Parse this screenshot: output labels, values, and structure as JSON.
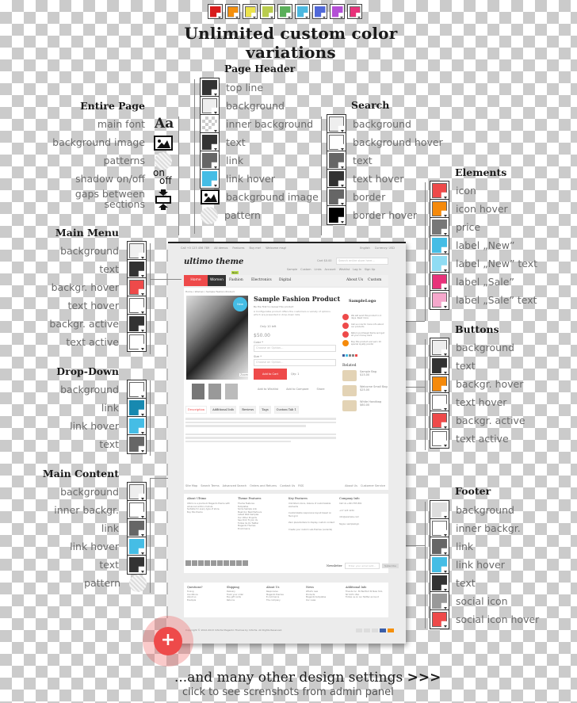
{
  "top_swatches": [
    "#d81c1c",
    "#f5900d",
    "#ece34c",
    "#b9cc4d",
    "#5aaf5a",
    "#4cb8e0",
    "#5068d8",
    "#b44fd6",
    "#e8327a"
  ],
  "headline": "Unlimited custom color variations",
  "entire_page": {
    "title": "Entire Page",
    "items": [
      {
        "label": "main font",
        "icon": "font-icon",
        "glyph": "Aa"
      },
      {
        "label": "background image",
        "icon": "image-icon"
      },
      {
        "label": "patterns",
        "icon": "pattern-icon"
      },
      {
        "label": "shadow on/off",
        "icon": "shadow-toggle-icon",
        "on": "on",
        "off": "off"
      },
      {
        "label": "gaps between sections",
        "icon": "gaps-icon"
      }
    ]
  },
  "page_header": {
    "title": "Page Header",
    "items": [
      {
        "label": "top line",
        "color": "#333333"
      },
      {
        "label": "background",
        "color": "#eeeeee"
      },
      {
        "label": "inner background",
        "color": "pattern"
      },
      {
        "label": "text",
        "color": "#333333"
      },
      {
        "label": "link",
        "color": "#666666"
      },
      {
        "label": "link hover",
        "color": "#45bde5"
      },
      {
        "label": "background image",
        "color": "image"
      },
      {
        "label": "pattern",
        "color": "circle"
      }
    ]
  },
  "search": {
    "title": "Search",
    "items": [
      {
        "label": "background",
        "color": "#eeeeee"
      },
      {
        "label": "background hover",
        "color": "#ffffff"
      },
      {
        "label": "text",
        "color": "#666666"
      },
      {
        "label": "text hover",
        "color": "#333333"
      },
      {
        "label": "border",
        "color": "#666666"
      },
      {
        "label": "border hover",
        "color": "#000000"
      }
    ]
  },
  "elements": {
    "title": "Elements",
    "items": [
      {
        "label": "icon",
        "color": "#ee4a4a"
      },
      {
        "label": "icon hover",
        "color": "#f58a0b"
      },
      {
        "label": "price",
        "color": "#777777"
      },
      {
        "label": "label „New”",
        "color": "#45bde5"
      },
      {
        "label": "label „New” text",
        "color": "#8fdcf3"
      },
      {
        "label": "label „Sale”",
        "color": "#e8327a"
      },
      {
        "label": "label „Sale” text",
        "color": "#f5a8cc"
      }
    ]
  },
  "main_menu": {
    "title": "Main Menu",
    "items": [
      {
        "label": "background",
        "color": "#f0f0f0"
      },
      {
        "label": "text",
        "color": "#333333"
      },
      {
        "label": "backgr. hover",
        "color": "#ee4a4a"
      },
      {
        "label": "text hover",
        "color": "#ffffff"
      },
      {
        "label": "backgr. active",
        "color": "#333333"
      },
      {
        "label": "text active",
        "color": "#ffffff"
      }
    ]
  },
  "drop_down": {
    "title": "Drop-Down",
    "items": [
      {
        "label": "background",
        "color": "#ffffff"
      },
      {
        "label": "link",
        "color": "#1789b0"
      },
      {
        "label": "link hover",
        "color": "#45bde5"
      },
      {
        "label": "text",
        "color": "#666666"
      }
    ]
  },
  "main_content": {
    "title": "Main Content",
    "items": [
      {
        "label": "background",
        "color": "#eeeeee"
      },
      {
        "label": "inner backgr.",
        "color": "#ffffff"
      },
      {
        "label": "link",
        "color": "#666666"
      },
      {
        "label": "link hover",
        "color": "#45bde5"
      },
      {
        "label": "text",
        "color": "#333333"
      },
      {
        "label": "pattern",
        "color": "circle"
      }
    ]
  },
  "buttons": {
    "title": "Buttons",
    "items": [
      {
        "label": "background",
        "color": "#eeeeee"
      },
      {
        "label": "text",
        "color": "#333333"
      },
      {
        "label": "backgr. hover",
        "color": "#f58a0b"
      },
      {
        "label": "text hover",
        "color": "#ffffff"
      },
      {
        "label": "backgr. active",
        "color": "#ee4a4a"
      },
      {
        "label": "text active",
        "color": "#ffffff"
      }
    ]
  },
  "footer": {
    "title": "Footer",
    "items": [
      {
        "label": "background",
        "color": "#dddddd"
      },
      {
        "label": "inner backgr.",
        "color": "#ffffff"
      },
      {
        "label": "link",
        "color": "#666666"
      },
      {
        "label": "link hover",
        "color": "#45bde5"
      },
      {
        "label": "text",
        "color": "#333333"
      },
      {
        "label": "social icon",
        "color": "#999999"
      },
      {
        "label": "social icon hover",
        "color": "#ee4a4a"
      }
    ]
  },
  "mock_site": {
    "topbar": [
      "Call +0 123 456 789",
      "All demos",
      "Features",
      "Buy me!",
      "Welcome msg!"
    ],
    "lang": "English",
    "currency": "Currency: USD",
    "logo": "ultimo theme",
    "cart": "Cart $0.00",
    "search_placeholder": "Search entire store here...",
    "account_links": [
      "Sample",
      "Custom",
      "Links",
      "Account",
      "Wishlist",
      "Log In",
      "Sign Up"
    ],
    "menu": [
      "Home",
      "Women",
      "Fashion",
      "Electronics",
      "Digital"
    ],
    "menu_right": [
      "About Us",
      "Custom"
    ],
    "menu_badge": "New",
    "breadcrumb": "Home / Women / Sample Fashion Product",
    "product_title": "Sample Fashion Product",
    "review_link": "Be the first to review this product",
    "new_label": "New",
    "zoom_label": "Zoom",
    "description": "A Configurable product offers the customers a variety of options which are presented in drop-down lists.",
    "stock": "Only 10 left",
    "price": "$50.00",
    "color_label": "Color *",
    "size_label": "Size *",
    "choose": "Choose an Option...",
    "add_to_cart": "Add to Cart",
    "qty_label": "Qty:",
    "qty": "1",
    "actions": [
      "Add to Wishlist",
      "Add to Compare",
      "Share"
    ],
    "sample_logo": "SampleLogo",
    "features": [
      "We will send this product in 2 days. Read more",
      "Call us now for more info about our products",
      "Return purchased items and get all your money back",
      "Buy this product and earn 10 special loyalty points!"
    ],
    "related_title": "Related",
    "related": [
      {
        "name": "Sample Bag",
        "price": "$15.00"
      },
      {
        "name": "Welcome Small Bag",
        "price": "$25.00"
      },
      {
        "name": "White Handbag",
        "price": "$60.00"
      }
    ],
    "tabs": [
      "Description",
      "Additional Info",
      "Reviews",
      "Tags",
      "Custom Tab 1"
    ],
    "footer_links": [
      "Site Map",
      "Search Terms",
      "Advanced Search",
      "Orders and Returns",
      "Contact Us",
      "RSS"
    ],
    "footer_links_right": [
      "About Us",
      "Customer Service"
    ],
    "footer_cols": [
      {
        "title": "About Ultimo",
        "lines": [
          "Ultimo is a premium Magento theme with advanced admin module.",
          "Suitable for every type of store.",
          "Buy this theme"
        ]
      },
      {
        "title": "Theme Features",
        "lines": [
          "Theme Features",
          "Templates",
          "Some Sample Link",
          "Meet Our Best Partners",
          "Latest Web Samples",
          "Our Other Projects",
          "See Click To Join Us",
          "Follow Us On Twitter",
          "Magento Themes",
          "Ecommerce"
        ]
      },
      {
        "title": "Key Features",
        "lines": [
          "Unlimited colors, dozens of customizable elements",
          "Customizable responsive layout based on fluid grid",
          "Zero placeholders to display custom content",
          "Create your custom sub-themes (variants)"
        ]
      },
      {
        "title": "Company Info",
        "lines": [
          "Call Us +001 555 801",
          "+17 123 1234",
          "info@example.com",
          "Skype: samplelogin"
        ]
      }
    ],
    "newsletter_label": "Newsletter",
    "newsletter_placeholder": "Enter your email add...",
    "subscribe": "Subscribe",
    "bottom_cols": [
      {
        "title": "Questions?",
        "lines": [
          "Tuning",
          "Conditions",
          "About us",
          "Example"
        ]
      },
      {
        "title": "Shipping",
        "lines": [
          "Delivery",
          "Track your order",
          "Buy gift cards",
          "Returns"
        ]
      },
      {
        "title": "About Us",
        "lines": [
          "Responsive",
          "Magento themes",
          "E-commerce",
          "The company"
        ]
      },
      {
        "title": "News",
        "lines": [
          "What's new",
          "Products",
          "Magento templates",
          "Our news"
        ]
      },
      {
        "title": "Additional Info",
        "lines": [
          "Friends Inc. 36 Bedford St New York, NY 0471 USA",
          "Follow us on our Twitter account"
        ]
      }
    ],
    "copyright": "Copyright © 2012-2013 Infortis Magento Themes by Infortis. All Rights Reserved."
  },
  "footer_cta": {
    "headline": "...and many other design settings",
    "arrows": ">>>",
    "subline": "click to see screnshots from admin panel"
  }
}
